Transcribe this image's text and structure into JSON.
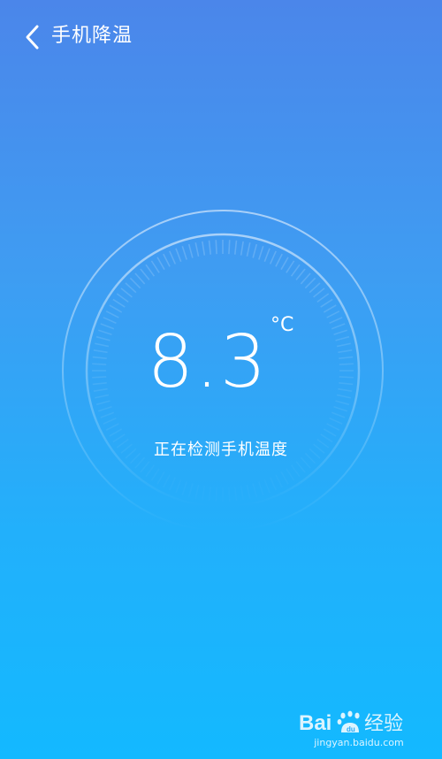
{
  "header": {
    "title": "手机降温",
    "back_icon": "chevron-left-icon"
  },
  "temperature": {
    "value": "8.3",
    "unit": "°C"
  },
  "status": {
    "text": "正在检测手机温度"
  },
  "watermark": {
    "brand": "Bai 经验",
    "url": "jingyan.baidu.com"
  },
  "colors": {
    "background_top": "#4b86ea",
    "background_bottom": "#13b9ff",
    "foreground": "#ffffff"
  }
}
